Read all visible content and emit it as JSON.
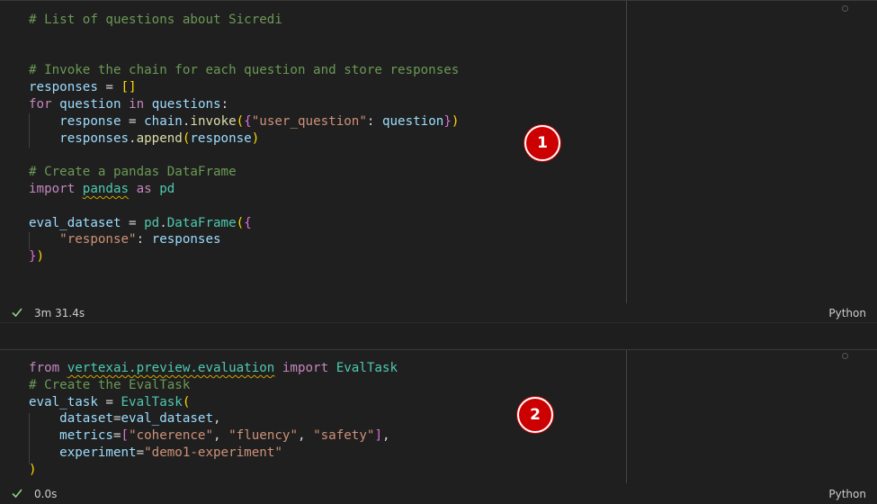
{
  "cell1": {
    "lines": [
      [
        {
          "t": "# List of questions about Sicredi",
          "c": "tok-comment"
        }
      ],
      [],
      [],
      [
        {
          "t": "# Invoke the chain for each question and store responses",
          "c": "tok-comment"
        }
      ],
      [
        {
          "t": "responses",
          "c": "tok-var"
        },
        {
          "t": " = ",
          "c": "tok-def"
        },
        {
          "t": "[]",
          "c": "tok-b1"
        }
      ],
      [
        {
          "t": "for",
          "c": "tok-kw"
        },
        {
          "t": " ",
          "c": "tok-def"
        },
        {
          "t": "question",
          "c": "tok-var"
        },
        {
          "t": " ",
          "c": "tok-def"
        },
        {
          "t": "in",
          "c": "tok-kw"
        },
        {
          "t": " ",
          "c": "tok-def"
        },
        {
          "t": "questions",
          "c": "tok-var"
        },
        {
          "t": ":",
          "c": "tok-def"
        }
      ],
      [
        {
          "t": "    ",
          "c": "tok-def"
        },
        {
          "t": "response",
          "c": "tok-var"
        },
        {
          "t": " = ",
          "c": "tok-def"
        },
        {
          "t": "chain",
          "c": "tok-var"
        },
        {
          "t": ".",
          "c": "tok-def"
        },
        {
          "t": "invoke",
          "c": "tok-fn"
        },
        {
          "t": "(",
          "c": "tok-b1"
        },
        {
          "t": "{",
          "c": "tok-b2"
        },
        {
          "t": "\"user_question\"",
          "c": "tok-str"
        },
        {
          "t": ": ",
          "c": "tok-def"
        },
        {
          "t": "question",
          "c": "tok-var"
        },
        {
          "t": "}",
          "c": "tok-b2"
        },
        {
          "t": ")",
          "c": "tok-b1"
        }
      ],
      [
        {
          "t": "    ",
          "c": "tok-def"
        },
        {
          "t": "responses",
          "c": "tok-var"
        },
        {
          "t": ".",
          "c": "tok-def"
        },
        {
          "t": "append",
          "c": "tok-fn"
        },
        {
          "t": "(",
          "c": "tok-b1"
        },
        {
          "t": "response",
          "c": "tok-var"
        },
        {
          "t": ")",
          "c": "tok-b1"
        }
      ],
      [],
      [
        {
          "t": "# Create a pandas DataFrame",
          "c": "tok-comment"
        }
      ],
      [
        {
          "t": "import",
          "c": "tok-kw"
        },
        {
          "t": " ",
          "c": "tok-def"
        },
        {
          "t": "pandas",
          "c": "tok-cls squiggle"
        },
        {
          "t": " ",
          "c": "tok-def"
        },
        {
          "t": "as",
          "c": "tok-kw"
        },
        {
          "t": " ",
          "c": "tok-def"
        },
        {
          "t": "pd",
          "c": "tok-cls"
        }
      ],
      [],
      [
        {
          "t": "eval_dataset",
          "c": "tok-var"
        },
        {
          "t": " = ",
          "c": "tok-def"
        },
        {
          "t": "pd",
          "c": "tok-cls"
        },
        {
          "t": ".",
          "c": "tok-def"
        },
        {
          "t": "DataFrame",
          "c": "tok-cls"
        },
        {
          "t": "(",
          "c": "tok-b1"
        },
        {
          "t": "{",
          "c": "tok-b2"
        }
      ],
      [
        {
          "t": "    ",
          "c": "tok-def"
        },
        {
          "t": "\"response\"",
          "c": "tok-str"
        },
        {
          "t": ": ",
          "c": "tok-def"
        },
        {
          "t": "responses",
          "c": "tok-var"
        }
      ],
      [
        {
          "t": "}",
          "c": "tok-b2"
        },
        {
          "t": ")",
          "c": "tok-b1"
        }
      ]
    ],
    "status": {
      "exec_time": "3m 31.4s",
      "language": "Python"
    },
    "badge": "1"
  },
  "cell2": {
    "lines": [
      [
        {
          "t": "from",
          "c": "tok-kw"
        },
        {
          "t": " ",
          "c": "tok-def"
        },
        {
          "t": "vertexai.preview.evaluation",
          "c": "tok-cls squiggle"
        },
        {
          "t": " ",
          "c": "tok-def"
        },
        {
          "t": "import",
          "c": "tok-kw"
        },
        {
          "t": " ",
          "c": "tok-def"
        },
        {
          "t": "EvalTask",
          "c": "tok-cls"
        }
      ],
      [
        {
          "t": "# Create the EvalTask",
          "c": "tok-comment"
        }
      ],
      [
        {
          "t": "eval_task",
          "c": "tok-var"
        },
        {
          "t": " = ",
          "c": "tok-def"
        },
        {
          "t": "EvalTask",
          "c": "tok-cls"
        },
        {
          "t": "(",
          "c": "tok-b1"
        }
      ],
      [
        {
          "t": "    ",
          "c": "tok-def"
        },
        {
          "t": "dataset",
          "c": "tok-var"
        },
        {
          "t": "=",
          "c": "tok-def"
        },
        {
          "t": "eval_dataset",
          "c": "tok-var"
        },
        {
          "t": ",",
          "c": "tok-def"
        }
      ],
      [
        {
          "t": "    ",
          "c": "tok-def"
        },
        {
          "t": "metrics",
          "c": "tok-var"
        },
        {
          "t": "=",
          "c": "tok-def"
        },
        {
          "t": "[",
          "c": "tok-b2"
        },
        {
          "t": "\"coherence\"",
          "c": "tok-str"
        },
        {
          "t": ", ",
          "c": "tok-def"
        },
        {
          "t": "\"fluency\"",
          "c": "tok-str"
        },
        {
          "t": ", ",
          "c": "tok-def"
        },
        {
          "t": "\"safety\"",
          "c": "tok-str"
        },
        {
          "t": "]",
          "c": "tok-b2"
        },
        {
          "t": ",",
          "c": "tok-def"
        }
      ],
      [
        {
          "t": "    ",
          "c": "tok-def"
        },
        {
          "t": "experiment",
          "c": "tok-var"
        },
        {
          "t": "=",
          "c": "tok-def"
        },
        {
          "t": "\"demo1-experiment\"",
          "c": "tok-str"
        }
      ],
      [
        {
          "t": ")",
          "c": "tok-b1"
        }
      ]
    ],
    "status": {
      "exec_time": "0.0s",
      "language": "Python"
    },
    "badge": "2"
  },
  "colors": {
    "background": "#1f1f1f",
    "badge": "#cc0000",
    "check": "#89d185"
  },
  "icons": {
    "success": "check-icon"
  }
}
